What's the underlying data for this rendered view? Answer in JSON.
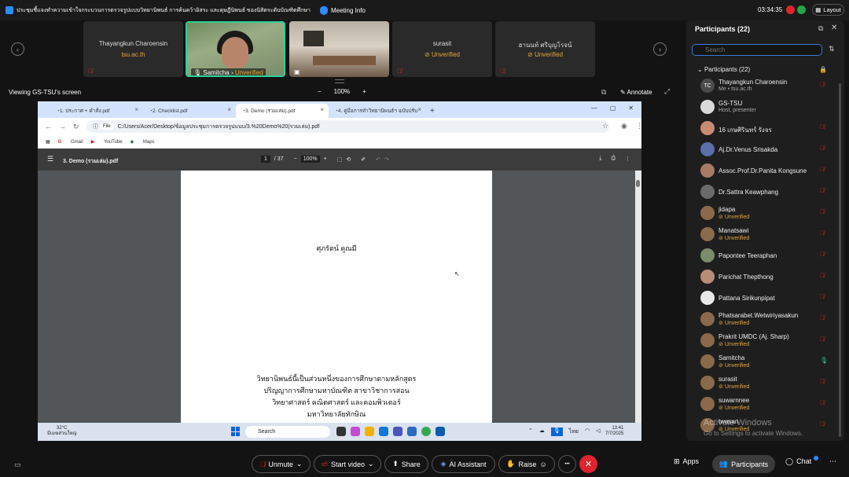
{
  "titlebar": {
    "meeting_title": "ประชุมชี้แจงทำความเข้าใจกระบวนการตรวจรูปแบบวิทยานิพนธ์ การค้นคว้าอิสระ และดุษฎีนิพนธ์ ของนิสิตระดับบัณฑิตศึกษา",
    "meeting_info": "Meeting Info",
    "timer": "03:34:35",
    "layout": "Layout"
  },
  "video_tiles": [
    {
      "name": "Thayangkun Charoensin",
      "sub": "tsu.ac.th"
    },
    {
      "name": "Samitcha",
      "status": "Unverified"
    },
    {
      "name": "",
      "status": ""
    },
    {
      "name": "surasit",
      "status": "Unverified"
    },
    {
      "name": "ฮานนท์ ศรีบุญโรจน์",
      "status": "Unverified"
    }
  ],
  "share_bar": {
    "viewing": "Viewing GS-TSU's screen",
    "zoom": "100%",
    "minus": "−",
    "plus": "+",
    "annotate": "Annotate"
  },
  "browser": {
    "tabs": [
      "1. ประกาศ + คำสั่ง.pdf",
      "2. Checklist.pdf",
      "3. Demo (รวมเล่ม).pdf",
      "4. คู่มือการทำวิทยานิพนธ์ฯ ฉบับปรับ"
    ],
    "new_tab": "+",
    "file_chip": "File",
    "url": "C:/Users/Acer/Desktop/ข้อมูลประชุมการตรวจรูปแบบ/3.%20Demo%20(รวมเล่ม).pdf",
    "bookmarks": [
      "Gmail",
      "YouTube",
      "Maps"
    ]
  },
  "pdf": {
    "title": "3. Demo (รวมเล่ม).pdf",
    "page_current": "1",
    "page_total": "/ 37",
    "zoom": "100%",
    "author": "ศุภรัตน์ คูณมี",
    "para_lines": [
      "วิทยานิพนธ์นี้เป็นส่วนหนึ่งของการศึกษาตามหลักสูตร",
      "ปริญญาการศึกษามหาบัณฑิต สาขาวิชาการสอน",
      "วิทยาศาสตร์ คณิตศาสตร์ และคอมพิวเตอร์",
      "มหาวิทยาลัยทักษิณ"
    ]
  },
  "taskbar": {
    "temp": "32°C",
    "weather": "มีเมฆส่วนใหญ่",
    "search": "Search",
    "lang": "ไทย",
    "time": "13:41",
    "date": "7/7/2025"
  },
  "participants": {
    "header": "Participants (22)",
    "search_placeholder": "Search",
    "group_label": "Participants (22)",
    "list": [
      {
        "name": "Thayangkun Charoensin",
        "sub": "Me • tsu.ac.th",
        "initials": "TC",
        "color": "#4a4a4a",
        "sub_type": "normal",
        "mic": "muted"
      },
      {
        "name": "GS-TSU",
        "sub": "Host, presenter",
        "initials": "",
        "color": "#d9d9d9",
        "sub_type": "normal",
        "mic": "none"
      },
      {
        "name": "16 เกษศิรินทร์ รังจร",
        "sub": "",
        "initials": "",
        "color": "#c98c73",
        "sub_type": "normal",
        "mic": "muted"
      },
      {
        "name": "Aj.Dr.Venus Srisakda",
        "sub": "",
        "initials": "",
        "color": "#5b6fa8",
        "sub_type": "normal",
        "mic": "muted"
      },
      {
        "name": "Assoc.Prof.Dr.Panita Kongsune",
        "sub": "",
        "initials": "",
        "color": "#a77b66",
        "sub_type": "normal",
        "mic": "muted"
      },
      {
        "name": "Dr.Sattra Keawphang",
        "sub": "",
        "initials": "",
        "color": "#6b6b6b",
        "sub_type": "normal",
        "mic": "muted"
      },
      {
        "name": "jidapa",
        "sub": "Unverified",
        "initials": "",
        "color": "#8a6a4a",
        "sub_type": "unverified",
        "mic": "muted"
      },
      {
        "name": "Manatsawi",
        "sub": "Unverified",
        "initials": "",
        "color": "#8a6a4a",
        "sub_type": "unverified",
        "mic": "muted"
      },
      {
        "name": "Papontee Teeraphan",
        "sub": "",
        "initials": "",
        "color": "#7a8c6a",
        "sub_type": "normal",
        "mic": "muted"
      },
      {
        "name": "Parichat Thepthong",
        "sub": "",
        "initials": "",
        "color": "#b78d7a",
        "sub_type": "normal",
        "mic": "muted"
      },
      {
        "name": "Pattana Sirikunpipat",
        "sub": "",
        "initials": "",
        "color": "#e8e8e8",
        "sub_type": "normal",
        "mic": "muted"
      },
      {
        "name": "Phatsarabet.Wetwiriyasakun",
        "sub": "Unverified",
        "initials": "",
        "color": "#8a6a4a",
        "sub_type": "unverified",
        "mic": "muted"
      },
      {
        "name": "Prakrit UMDC (Aj. Sharp)",
        "sub": "Unverified",
        "initials": "",
        "color": "#8a6a4a",
        "sub_type": "unverified",
        "mic": "muted"
      },
      {
        "name": "Samitcha",
        "sub": "Unverified",
        "initials": "",
        "color": "#8a6a4a",
        "sub_type": "unverified",
        "mic": "on"
      },
      {
        "name": "surasit",
        "sub": "Unverified",
        "initials": "",
        "color": "#8a6a4a",
        "sub_type": "unverified",
        "mic": "muted"
      },
      {
        "name": "suwarnnee",
        "sub": "Unverified",
        "initials": "",
        "color": "#8a6a4a",
        "sub_type": "unverified",
        "mic": "muted"
      },
      {
        "name": "twasan",
        "sub": "Unverified",
        "initials": "",
        "color": "#8a6a4a",
        "sub_type": "unverified",
        "mic": "muted"
      }
    ]
  },
  "watermark": {
    "title": "Activate Windows",
    "sub": "Go to Settings to activate Windows."
  },
  "toolbar": {
    "unmute": "Unmute",
    "start_video": "Start video",
    "share": "Share",
    "ai_assistant": "AI Assistant",
    "raise": "Raise",
    "more": "•••",
    "apps": "Apps",
    "participants": "Participants",
    "chat": "Chat"
  }
}
